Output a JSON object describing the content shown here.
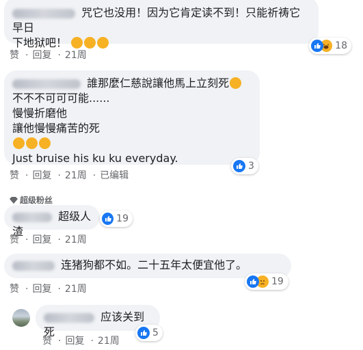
{
  "colors": {
    "like_blue": "#1877f2",
    "emoji_yellow": "#f7b125",
    "bubble_bg": "#f0f2f5",
    "meta_gray": "#65676b"
  },
  "comments": [
    {
      "lines": [
        "咒它也没用！因为它肯定读不到！只能祈祷它早日",
        "下地狱吧！"
      ],
      "emoji_icons": [
        "laughing-crying-emoji",
        "laughing-crying-emoji",
        "laughing-crying-emoji"
      ],
      "actions": {
        "like": "赞",
        "reply": "回复",
        "time": "21周"
      },
      "reactions": {
        "icons": [
          "like-icon",
          "haha-emoji"
        ],
        "count": "18"
      }
    },
    {
      "lines": [
        "誰那麼仁慈說讓他馬上立刻死",
        "不不不可可可能......",
        "慢慢折磨他",
        "讓他慢慢痛苦的死",
        "Just bruise his ku ku everyday."
      ],
      "emoji_icons": [
        "angry-emoji",
        "angry-emoji",
        "angry-emoji",
        "angry-emoji"
      ],
      "actions": {
        "like": "赞",
        "reply": "回复",
        "time": "21周",
        "edited": "已编辑"
      },
      "reactions": {
        "icons": [
          "like-icon"
        ],
        "count": "3"
      }
    },
    {
      "badge": "超级粉丝",
      "lines": [
        "超级人渣"
      ],
      "actions": {
        "like": "赞",
        "reply": "回复",
        "time": "21周"
      },
      "reactions": {
        "icons": [
          "like-icon"
        ],
        "count": "19"
      }
    },
    {
      "lines": [
        "连猪狗都不如。二十五年太便宜他了。"
      ],
      "actions": {
        "like": "赞",
        "reply": "回复",
        "time": "21周"
      },
      "reactions": {
        "icons": [
          "like-icon",
          "sad-emoji"
        ],
        "count": "19"
      }
    },
    {
      "lines": [
        "应该关到死"
      ],
      "actions": {
        "like": "赞",
        "reply": "回复",
        "time": "21周"
      },
      "reactions": {
        "icons": [
          "like-icon"
        ],
        "count": "5"
      }
    }
  ]
}
